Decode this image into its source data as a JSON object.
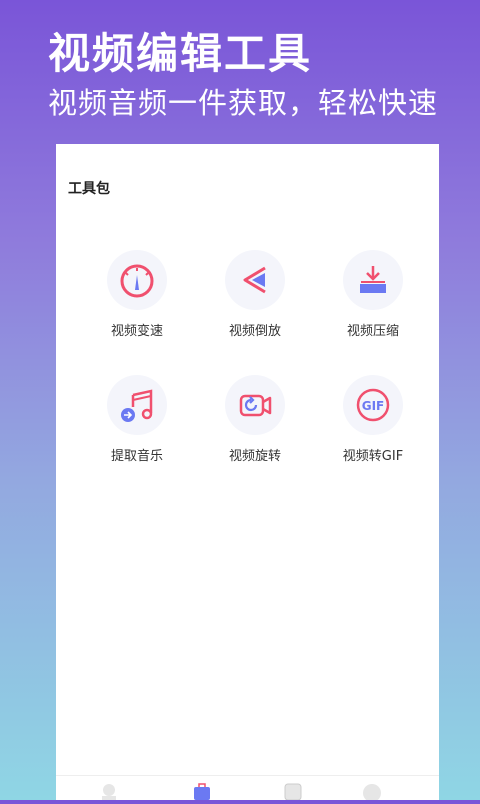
{
  "hero": {
    "title": "视频编辑工具",
    "subtitle": "视频音频一件获取，轻松快速"
  },
  "section": {
    "title": "工具包"
  },
  "tools": [
    {
      "label": "视频变速",
      "icon": "speedometer-icon"
    },
    {
      "label": "视频倒放",
      "icon": "rewind-icon"
    },
    {
      "label": "视频压缩",
      "icon": "compress-download-icon"
    },
    {
      "label": "提取音乐",
      "icon": "music-note-icon"
    },
    {
      "label": "视频旋转",
      "icon": "rotate-video-icon"
    },
    {
      "label": "视频转GIF",
      "icon": "gif-icon"
    }
  ],
  "tabbar": [
    "profile-icon",
    "toolbox-icon",
    "document-icon",
    "user-icon"
  ],
  "colors": {
    "accent_red": "#f0506e",
    "accent_blue": "#6b79f2",
    "icon_bg": "#f4f5fb"
  }
}
